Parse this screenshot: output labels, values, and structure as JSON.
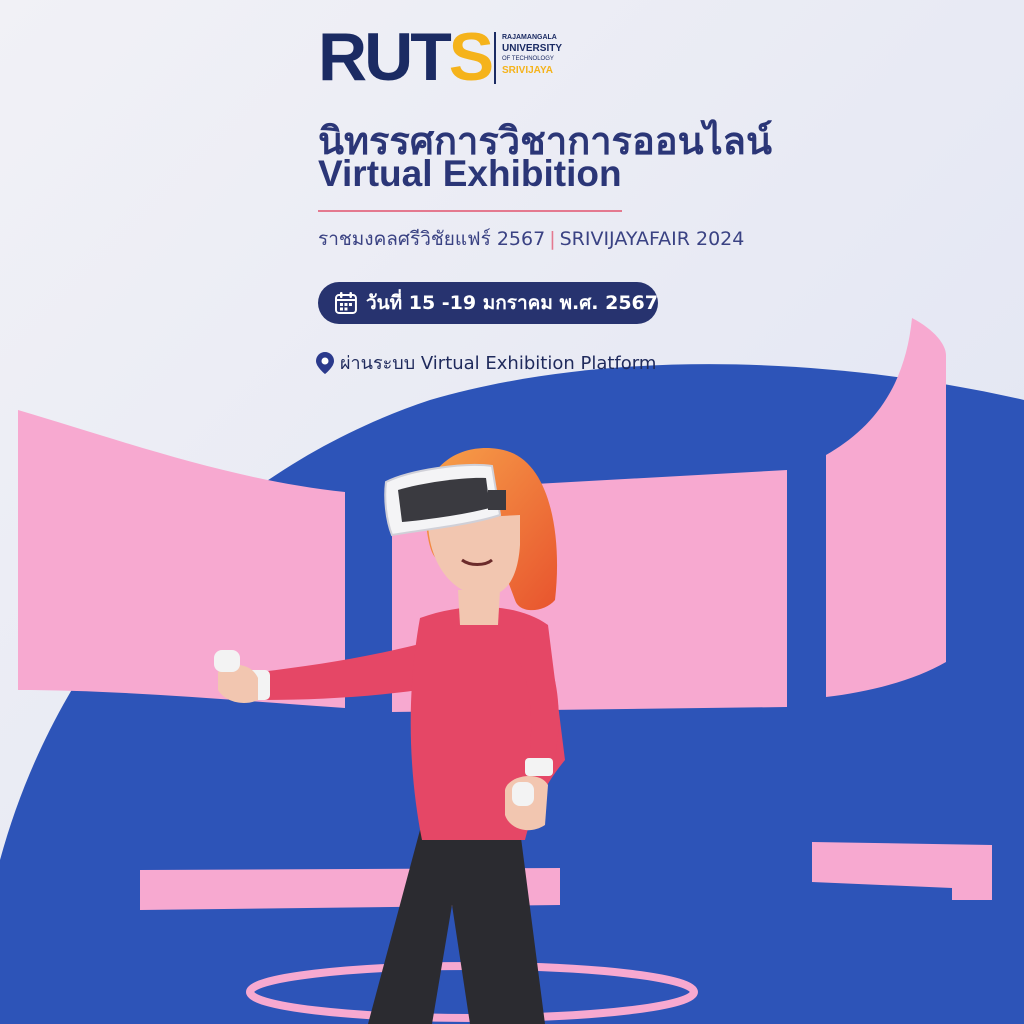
{
  "logo": {
    "brand_main": "RUT",
    "brand_accent": "S",
    "line1": "RAJAMANGALA",
    "line2": "UNIVERSITY",
    "line3": "OF TECHNOLOGY",
    "line4": "SRIVIJAYA"
  },
  "title": {
    "thai": "นิทรรศการวิชาการออนไลน์",
    "english": "Virtual Exhibition"
  },
  "subtitle": {
    "thai": "ราชมงคลศรีวิชัยแฟร์ 2567",
    "separator": "|",
    "english": "SRIVIJAYAFAIR 2024"
  },
  "date_text": "วันที่ 15 -19 มกราคม พ.ศ. 2567",
  "location_text": "ผ่านระบบ Virtual Exhibition Platform",
  "icons": [
    "calendar-icon",
    "location-pin-icon"
  ],
  "colors": {
    "navy": "#27336f",
    "title": "#2b3677",
    "accent_yellow": "#f5b31b",
    "pink": "#f7a9d0",
    "blue": "#2d54b8",
    "background": "#e9ebf5",
    "shirt": "#e54766"
  }
}
